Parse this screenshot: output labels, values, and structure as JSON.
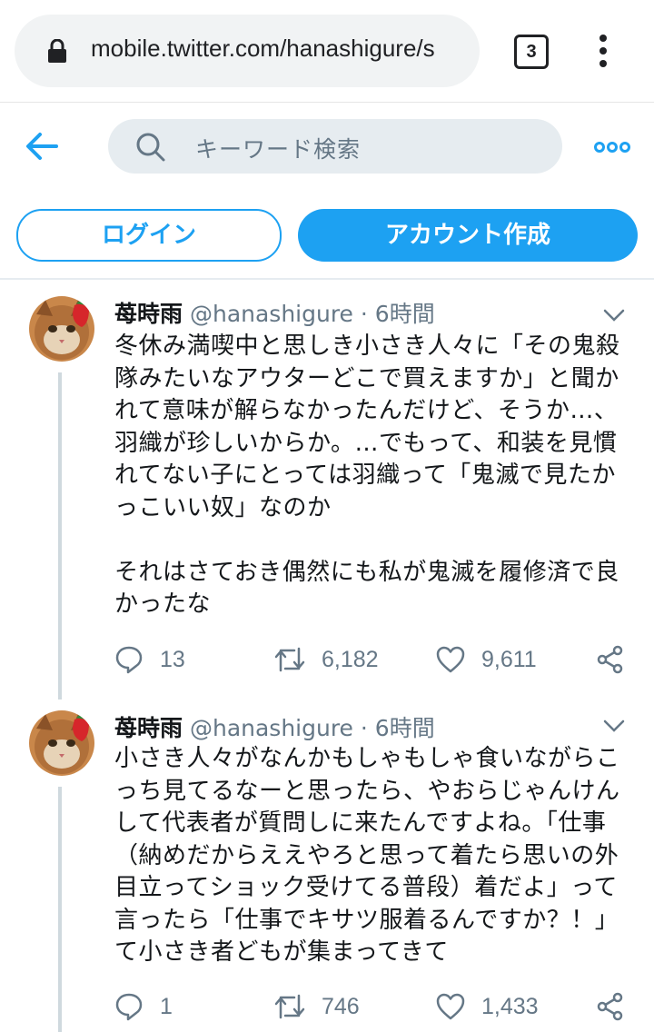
{
  "browser": {
    "url": "mobile.twitter.com/hanashigure/s",
    "tab_count": "3"
  },
  "header": {
    "search_placeholder": "キーワード検索"
  },
  "auth": {
    "login_label": "ログイン",
    "signup_label": "アカウント作成"
  },
  "colors": {
    "accent": "#1da1f2",
    "muted": "#657786"
  },
  "tweets": [
    {
      "name": "苺時雨",
      "handle": "@hanashigure",
      "sep": "·",
      "time": "6時間",
      "body": "冬休み満喫中と思しき小さき人々に「その鬼殺隊みたいなアウターどこで買えますか」と聞かれて意味が解らなかったんだけど、そうか…、羽織が珍しいからか。…でもって、和装を見慣れてない子にとっては羽織って「鬼滅で見たかっこいい奴」なのか\n\nそれはさておき偶然にも私が鬼滅を履修済で良かったな",
      "replies": "13",
      "retweets": "6,182",
      "likes": "9,611"
    },
    {
      "name": "苺時雨",
      "handle": "@hanashigure",
      "sep": "·",
      "time": "6時間",
      "body": "小さき人々がなんかもしゃもしゃ食いながらこっち見てるなーと思ったら、やおらじゃんけんして代表者が質問しに来たんですよね。「仕事（納めだからええやろと思って着たら思いの外目立ってショック受けてる普段）着だよ」って言ったら「仕事でキサツ服着るんですか？！」て小さき者どもが集まってきて",
      "replies": "1",
      "retweets": "746",
      "likes": "1,433"
    }
  ]
}
